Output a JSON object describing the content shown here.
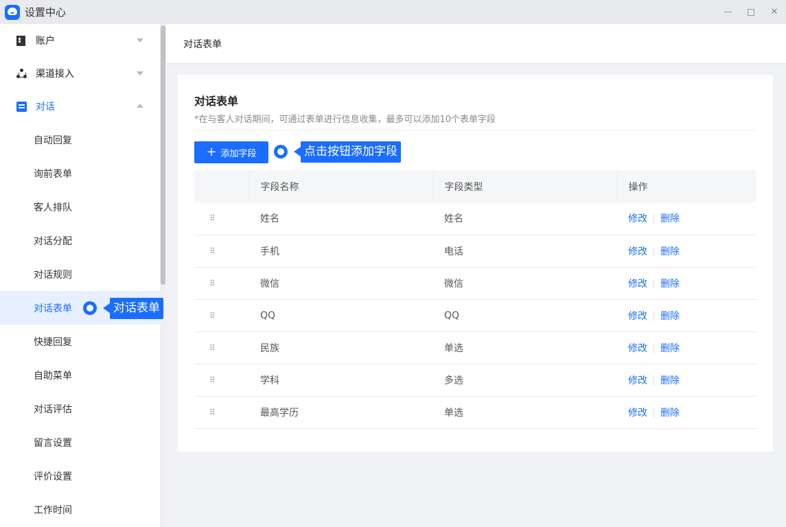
{
  "window": {
    "title": "设置中心",
    "accent": "#1a6dff"
  },
  "sidebar": {
    "groups": [
      {
        "label": "账户",
        "icon": "building-icon",
        "expanded": false
      },
      {
        "label": "渠道接入",
        "icon": "network-icon",
        "expanded": false
      },
      {
        "label": "对话",
        "icon": "chat-icon",
        "expanded": true
      }
    ],
    "items": [
      {
        "label": "自动回复"
      },
      {
        "label": "询前表单"
      },
      {
        "label": "客人排队"
      },
      {
        "label": "对话分配"
      },
      {
        "label": "对话规则"
      },
      {
        "label": "对话表单",
        "selected": true
      },
      {
        "label": "快捷回复"
      },
      {
        "label": "自助菜单"
      },
      {
        "label": "对话评估"
      },
      {
        "label": "留言设置"
      },
      {
        "label": "评价设置"
      },
      {
        "label": "工作时间"
      }
    ],
    "tip": "对话表单"
  },
  "main": {
    "breadcrumb": "对话表单",
    "title": "对话表单",
    "description": "*在与客人对话期间，可通过表单进行信息收集，最多可以添加10个表单字段",
    "add_button": "添加字段",
    "add_tip": "点击按钮添加字段",
    "table": {
      "headers": [
        "",
        "字段名称",
        "字段类型",
        "操作"
      ],
      "actions": {
        "edit": "修改",
        "delete": "删除"
      },
      "rows": [
        {
          "name": "姓名",
          "type": "姓名"
        },
        {
          "name": "手机",
          "type": "电话"
        },
        {
          "name": "微信",
          "type": "微信"
        },
        {
          "name": "QQ",
          "type": "QQ"
        },
        {
          "name": "民族",
          "type": "单选"
        },
        {
          "name": "学科",
          "type": "多选"
        },
        {
          "name": "最高学历",
          "type": "单选"
        }
      ]
    }
  }
}
